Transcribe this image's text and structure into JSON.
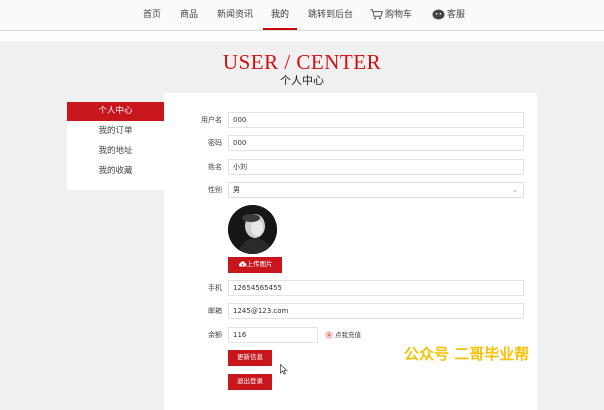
{
  "nav": {
    "items": [
      "首页",
      "商品",
      "新闻资讯",
      "我的",
      "跳转到后台"
    ],
    "cart_label": "购物车",
    "service_label": "客服"
  },
  "header": {
    "title_en": "USER / CENTER",
    "title_zh": "个人中心"
  },
  "sidebar": {
    "items": [
      "个人中心",
      "我的订单",
      "我的地址",
      "我的收藏"
    ]
  },
  "form": {
    "username": {
      "label": "用户名",
      "value": "000"
    },
    "password": {
      "label": "密码",
      "value": "000"
    },
    "name": {
      "label": "姓名",
      "value": "小刘"
    },
    "gender": {
      "label": "性别",
      "value": "男"
    },
    "upload_label": "上传图片",
    "phone": {
      "label": "手机",
      "value": "12654565455"
    },
    "email": {
      "label": "邮箱",
      "value": "1245@123.com"
    },
    "balance": {
      "label": "余额",
      "value": "116"
    },
    "recharge_label": "点我充值",
    "update_label": "更新信息",
    "logout_label": "退出登录"
  },
  "watermark": "公众号 二哥毕业帮",
  "colors": {
    "accent": "#c8161d",
    "watermark": "#f5c20a"
  },
  "icons": [
    "cart-icon",
    "wechat-icon",
    "cloud-upload-icon",
    "recharge-icon",
    "chevron-down-icon"
  ]
}
